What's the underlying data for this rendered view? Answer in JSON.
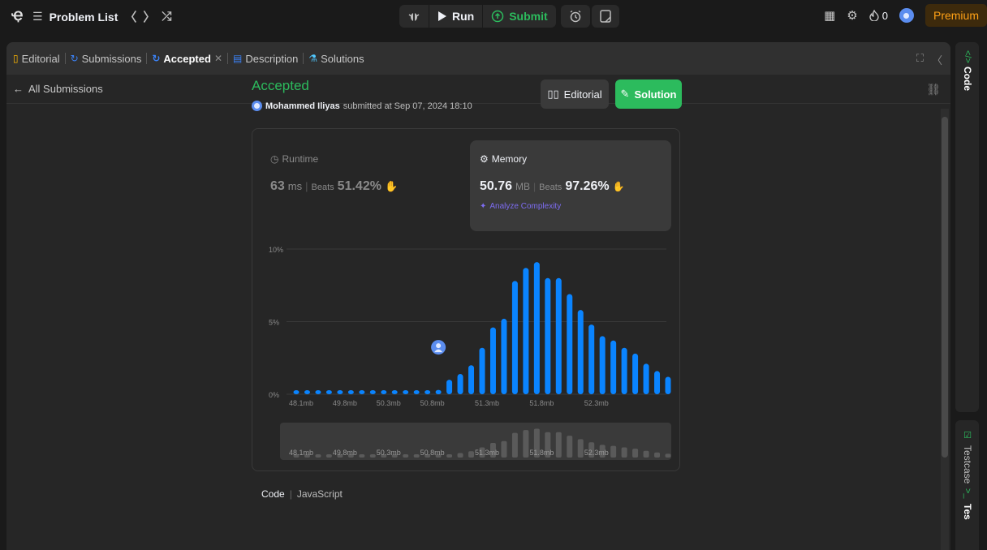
{
  "topbar": {
    "logo_glyph": "Ҿ",
    "problem_list_label": "Problem List",
    "prev_glyph": "〈",
    "next_glyph": "〉",
    "shuffle_glyph": "⤮",
    "run_label": "Run",
    "submit_label": "Submit",
    "streak_count": "0",
    "premium_label": "Premium"
  },
  "tabs": [
    {
      "label": "Editorial",
      "icon": "book-icon"
    },
    {
      "label": "Submissions",
      "icon": "history-icon"
    },
    {
      "label": "Accepted",
      "icon": "history-icon",
      "active": true
    },
    {
      "label": "Description",
      "icon": "document-icon"
    },
    {
      "label": "Solutions",
      "icon": "flask-icon"
    }
  ],
  "subbar": {
    "back_label": "All Submissions"
  },
  "result": {
    "status": "Accepted",
    "user": "Mohammed Iliyas",
    "submitted_text": "submitted at Sep 07, 2024 18:10",
    "editorial_button": "Editorial",
    "solution_button": "Solution"
  },
  "runtime": {
    "label": "Runtime",
    "value": "63",
    "unit": "ms",
    "beats_label": "Beats",
    "beats_value": "51.42%"
  },
  "memory": {
    "label": "Memory",
    "value": "50.76",
    "unit": "MB",
    "beats_label": "Beats",
    "beats_value": "97.26%",
    "analyze_label": "Analyze Complexity"
  },
  "chart_data": {
    "type": "bar",
    "title": "",
    "xlabel": "",
    "ylabel": "",
    "ylim": [
      0,
      10
    ],
    "y_ticks": [
      "10%",
      "5%",
      "0%"
    ],
    "x_tick_labels": [
      "48.1mb",
      "49.8mb",
      "50.3mb",
      "50.8mb",
      "51.3mb",
      "51.8mb",
      "52.3mb"
    ],
    "values": [
      0.2,
      0.2,
      0.2,
      0.2,
      0.2,
      0.2,
      0.2,
      0.2,
      0.2,
      0.2,
      0.2,
      0.2,
      0.2,
      0.3,
      1.0,
      1.4,
      2.0,
      3.2,
      4.6,
      5.2,
      7.8,
      8.7,
      9.1,
      8.0,
      8.0,
      6.9,
      5.8,
      4.8,
      4.0,
      3.7,
      3.2,
      2.8,
      2.1,
      1.6,
      1.2
    ],
    "user_bar_index": 14,
    "color": "#0a84ff",
    "mini_values": [
      0.2,
      0.2,
      0.2,
      0.2,
      0.2,
      0.2,
      0.2,
      0.2,
      0.2,
      0.2,
      0.2,
      0.2,
      0.2,
      0.3,
      1.0,
      1.4,
      2.0,
      3.2,
      4.6,
      5.2,
      7.8,
      8.7,
      9.1,
      8.0,
      8.0,
      6.9,
      5.8,
      4.8,
      4.0,
      3.7,
      3.2,
      2.8,
      2.1,
      1.6,
      1.2
    ],
    "mini_color": "#5a5a5a"
  },
  "code": {
    "label": "Code",
    "language": "JavaScript"
  },
  "side": {
    "code_label": "Code",
    "testcase_label": "Testcase",
    "test_result_label": "Tes"
  },
  "colors": {
    "accent": "#2cbb5d",
    "premium": "#ffa116",
    "bar": "#0a84ff",
    "analyze": "#7d6cf1"
  }
}
